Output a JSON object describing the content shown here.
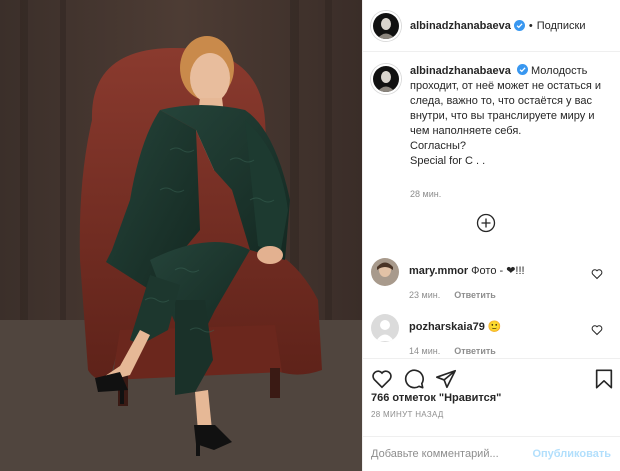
{
  "post": {
    "username": "albinadzhanabaeva",
    "follow_label": "Подписки",
    "separator": "•",
    "caption_lines": [
      "Молодость",
      "проходит, от неё может не остаться и",
      "следа, важно то, что остаётся у вас",
      "внутри, что вы транслируете миру и",
      "чем наполняете себя.",
      "Согласны?",
      "Special for С . ."
    ],
    "caption_time": "28 мин."
  },
  "comments": [
    {
      "username": "mary.mmor",
      "text": "Фото - ❤!!!",
      "time": "23 мин.",
      "reply": "Ответить"
    },
    {
      "username": "pozharskaia79",
      "text": "🙂",
      "time": "14 мин.",
      "reply": "Ответить"
    }
  ],
  "likes": "766 отметок \"Нравится\"",
  "time_ago": "28 МИНУТ НАЗАД",
  "add_comment": {
    "placeholder": "Добавьте комментарий...",
    "publish": "Опубликовать"
  },
  "colors": {
    "accent": "#0095f6",
    "publish_disabled": "#b2dffc",
    "verified": "#3897f0",
    "suit": "#1f3a31",
    "chair": "#7a2e24"
  },
  "icons": [
    "verified-icon",
    "load-more-icon",
    "heart-icon",
    "comment-icon",
    "share-icon",
    "save-icon"
  ]
}
